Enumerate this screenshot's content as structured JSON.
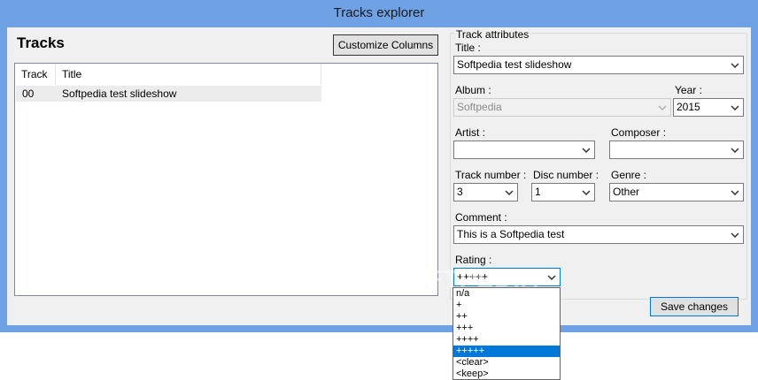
{
  "window": {
    "title": "Tracks explorer"
  },
  "tracks_panel": {
    "title": "Tracks",
    "customize_label": "Customize Columns",
    "columns": [
      "Track",
      "Title"
    ],
    "rows": [
      {
        "track": "00",
        "title": "Softpedia test slideshow"
      }
    ]
  },
  "attributes": {
    "group_label": "Track attributes",
    "title_label": "Title :",
    "title_value": "Softpedia test slideshow",
    "album_label": "Album :",
    "album_value": "Softpedia",
    "year_label": "Year :",
    "year_value": "2015",
    "artist_label": "Artist :",
    "artist_value": "",
    "composer_label": "Composer :",
    "composer_value": "",
    "track_number_label": "Track number :",
    "track_number_value": "3",
    "disc_number_label": "Disc number :",
    "disc_number_value": "1",
    "genre_label": "Genre :",
    "genre_value": "Other",
    "comment_label": "Comment :",
    "comment_value": "This is a Softpedia test",
    "rating_label": "Rating :",
    "rating_value": "+++++",
    "rating_options": [
      "n/a",
      "+",
      "++",
      "+++",
      "++++",
      "+++++",
      "<clear>",
      "<keep>"
    ],
    "save_label": "Save changes"
  },
  "watermark": "SOFTPEDIA",
  "icons": {
    "dropdown_arrow": "chevron-down-icon"
  }
}
